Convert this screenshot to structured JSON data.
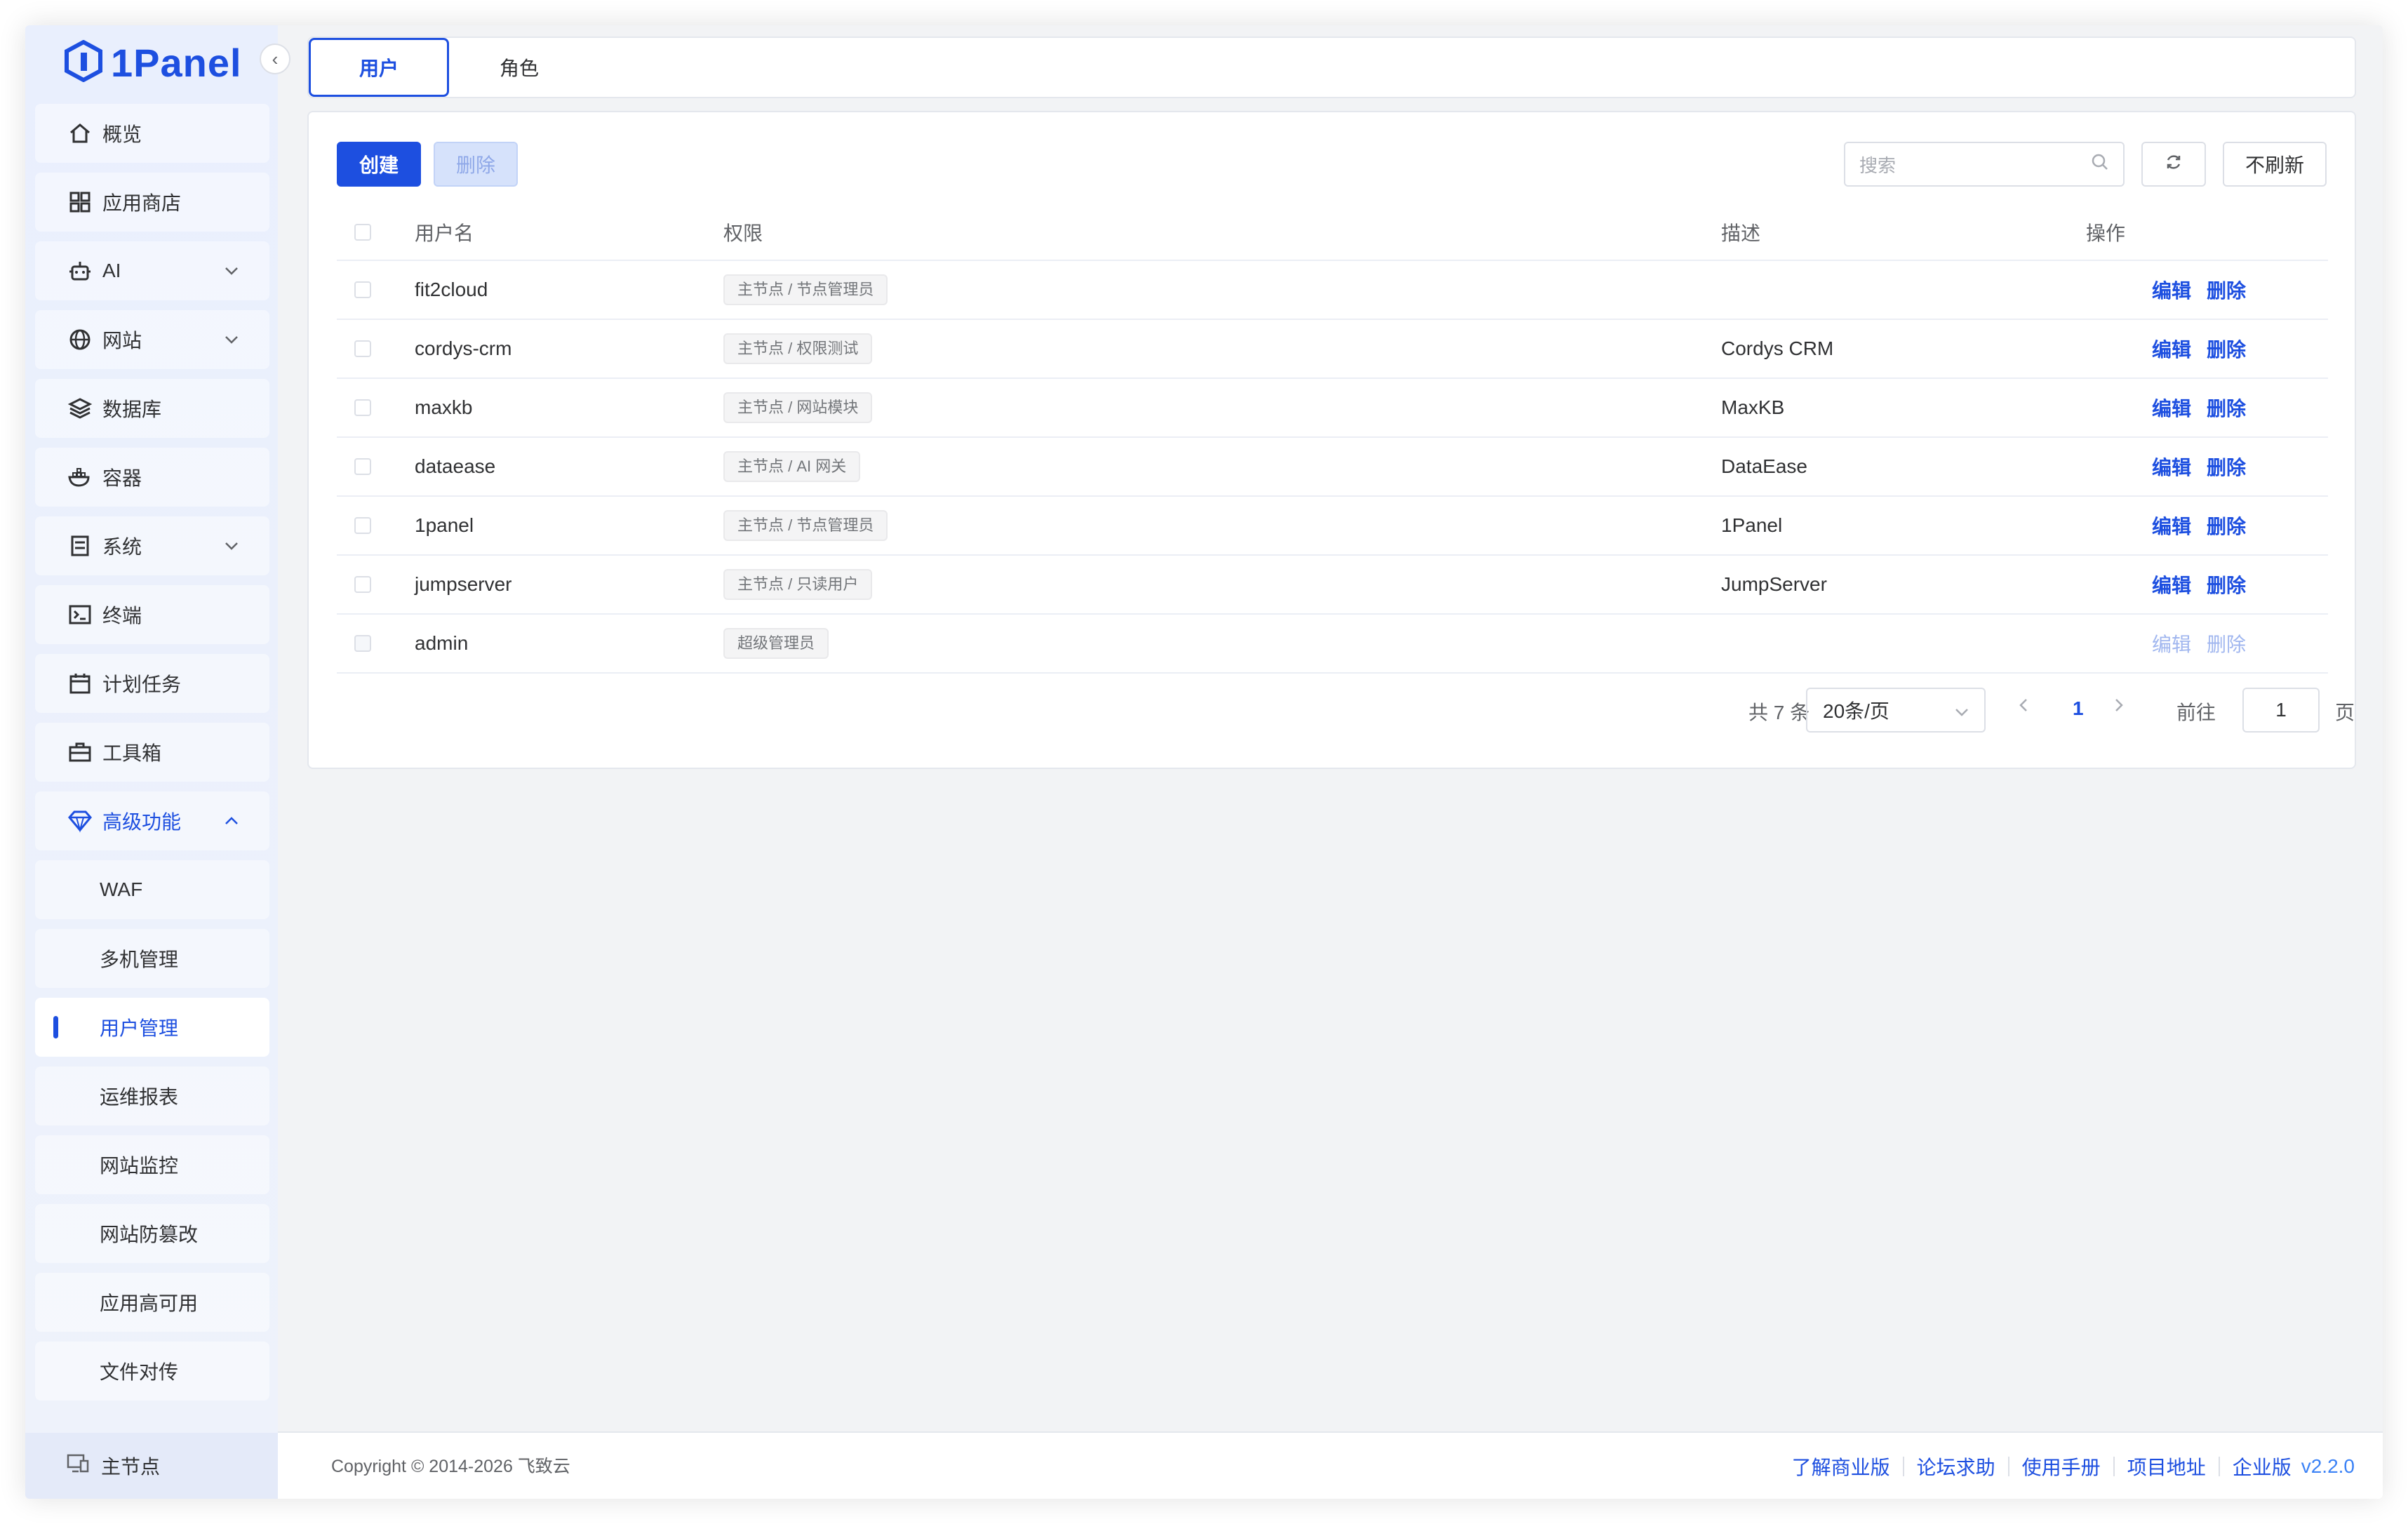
{
  "brand": {
    "name": "1Panel"
  },
  "sidebar": {
    "items": [
      {
        "label": "概览",
        "icon": "home-icon"
      },
      {
        "label": "应用商店",
        "icon": "grid-icon"
      },
      {
        "label": "AI",
        "icon": "robot-icon"
      },
      {
        "label": "网站",
        "icon": "globe-icon"
      },
      {
        "label": "数据库",
        "icon": "layers-icon"
      },
      {
        "label": "容器",
        "icon": "docker-icon"
      },
      {
        "label": "系统",
        "icon": "server-icon"
      },
      {
        "label": "终端",
        "icon": "terminal-icon"
      },
      {
        "label": "计划任务",
        "icon": "calendar-icon"
      },
      {
        "label": "工具箱",
        "icon": "toolbox-icon"
      },
      {
        "label": "高级功能",
        "icon": "diamond-icon"
      }
    ],
    "subitems": [
      {
        "label": "WAF"
      },
      {
        "label": "多机管理"
      },
      {
        "label": "用户管理"
      },
      {
        "label": "运维报表"
      },
      {
        "label": "网站监控"
      },
      {
        "label": "网站防篡改"
      },
      {
        "label": "应用高可用"
      },
      {
        "label": "文件对传"
      }
    ],
    "footer_label": "主节点"
  },
  "tabs": {
    "users": "用户",
    "roles": "角色"
  },
  "toolbar": {
    "create": "创建",
    "delete": "删除",
    "search_placeholder": "搜索",
    "no_refresh": "不刷新"
  },
  "table": {
    "headers": {
      "username": "用户名",
      "permission": "权限",
      "description": "描述",
      "actions": "操作"
    },
    "rows": [
      {
        "username": "fit2cloud",
        "permission": "主节点 / 节点管理员",
        "description": "",
        "edit": "编辑",
        "delete": "删除"
      },
      {
        "username": "cordys-crm",
        "permission": "主节点 / 权限测试",
        "description": "Cordys CRM",
        "edit": "编辑",
        "delete": "删除"
      },
      {
        "username": "maxkb",
        "permission": "主节点 / 网站模块",
        "description": "MaxKB",
        "edit": "编辑",
        "delete": "删除"
      },
      {
        "username": "dataease",
        "permission": "主节点 / AI 网关",
        "description": "DataEase",
        "edit": "编辑",
        "delete": "删除"
      },
      {
        "username": "1panel",
        "permission": "主节点 / 节点管理员",
        "description": "1Panel",
        "edit": "编辑",
        "delete": "删除"
      },
      {
        "username": "jumpserver",
        "permission": "主节点 / 只读用户",
        "description": "JumpServer",
        "edit": "编辑",
        "delete": "删除"
      },
      {
        "username": "admin",
        "permission": "超级管理员",
        "description": "",
        "edit": "编辑",
        "delete": "删除"
      }
    ]
  },
  "pagination": {
    "total": "共 7 条",
    "page_size": "20条/页",
    "current_page": "1",
    "goto_label": "前往",
    "goto_value": "1",
    "page_unit": "页"
  },
  "footer": {
    "copyright": "Copyright © 2014-2026 飞致云",
    "links": [
      "了解商业版",
      "论坛求助",
      "使用手册",
      "项目地址",
      "企业版"
    ],
    "version": "v2.2.0"
  },
  "colors": {
    "accent": "#1d4fe0",
    "sidebar_bg": "#e9effd",
    "page_bg": "#f2f3f5"
  }
}
